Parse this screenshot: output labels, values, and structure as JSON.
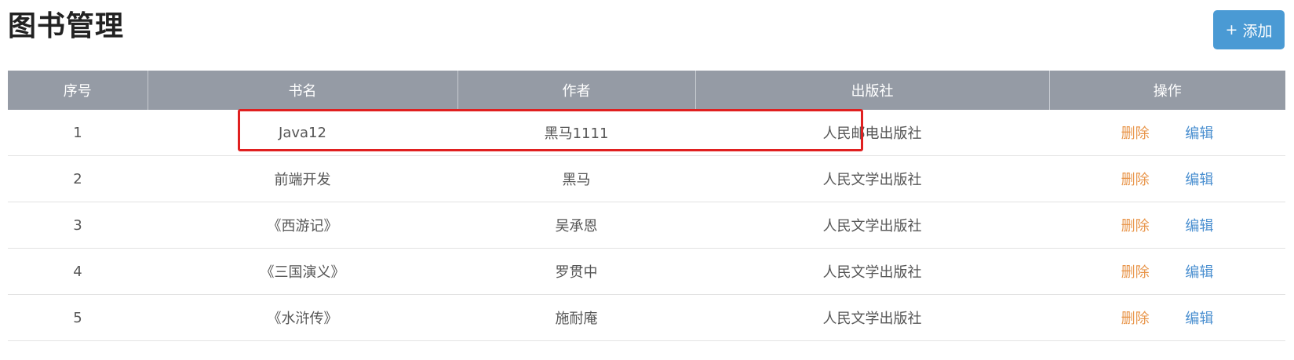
{
  "page": {
    "title": "图书管理",
    "add_button": {
      "icon": "plus-icon",
      "icon_glyph": "+",
      "label": "添加",
      "color": "#4a9ad4"
    }
  },
  "table": {
    "headers": [
      "序号",
      "书名",
      "作者",
      "出版社",
      "操作"
    ],
    "header_color": "#959ba5",
    "rows": [
      {
        "index": "1",
        "title": "Java12",
        "author": "黑马1111",
        "publisher": "人民邮电出版社",
        "delete": "删除",
        "edit": "编辑"
      },
      {
        "index": "2",
        "title": "前端开发",
        "author": "黑马",
        "publisher": "人民文学出版社",
        "delete": "删除",
        "edit": "编辑"
      },
      {
        "index": "3",
        "title": "《西游记》",
        "author": "吴承恩",
        "publisher": "人民文学出版社",
        "delete": "删除",
        "edit": "编辑"
      },
      {
        "index": "4",
        "title": "《三国演义》",
        "author": "罗贯中",
        "publisher": "人民文学出版社",
        "delete": "删除",
        "edit": "编辑"
      },
      {
        "index": "5",
        "title": "《水浒传》",
        "author": "施耐庵",
        "publisher": "人民文学出版社",
        "delete": "删除",
        "edit": "编辑"
      }
    ],
    "delete_color": "#e8954a",
    "edit_color": "#4a8fd0"
  },
  "annotation": {
    "highlight_color": "#e02020"
  }
}
